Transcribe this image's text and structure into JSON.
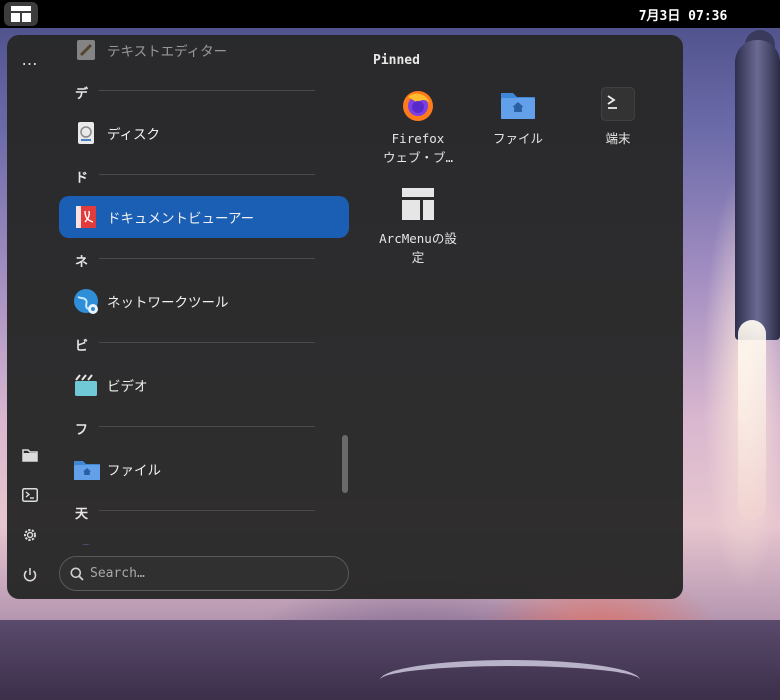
{
  "topbar": {
    "clock": "7月3日 07:36"
  },
  "sidebar": {
    "more_label": "…"
  },
  "app_list": [
    {
      "kind": "app",
      "label": "テキストエディター",
      "icon": "text-editor-icon"
    },
    {
      "kind": "section",
      "label": "デ"
    },
    {
      "kind": "app",
      "label": "ディスク",
      "icon": "disk-icon"
    },
    {
      "kind": "section",
      "label": "ド"
    },
    {
      "kind": "app",
      "label": "ドキュメントビューアー",
      "icon": "document-viewer-icon",
      "selected": true
    },
    {
      "kind": "section",
      "label": "ネ"
    },
    {
      "kind": "app",
      "label": "ネットワークツール",
      "icon": "network-tools-icon"
    },
    {
      "kind": "section",
      "label": "ビ"
    },
    {
      "kind": "app",
      "label": "ビデオ",
      "icon": "video-icon"
    },
    {
      "kind": "section",
      "label": "フ"
    },
    {
      "kind": "app",
      "label": "ファイル",
      "icon": "files-folder-icon"
    },
    {
      "kind": "section",
      "label": "天"
    }
  ],
  "search": {
    "placeholder": "Search…"
  },
  "pinned": {
    "title": "Pinned",
    "apps": [
      {
        "line1": "Firefox",
        "line2": "ウェブ・ブ…",
        "icon": "firefox-icon"
      },
      {
        "line1": "ファイル",
        "line2": "",
        "icon": "files-folder-icon"
      },
      {
        "line1": "端末",
        "line2": "",
        "icon": "terminal-icon"
      },
      {
        "line1": "ArcMenuの設",
        "line2": "定",
        "icon": "arcmenu-settings-icon"
      }
    ]
  },
  "colors": {
    "accent": "#1a5fb4",
    "menu_bg": "#282828"
  }
}
